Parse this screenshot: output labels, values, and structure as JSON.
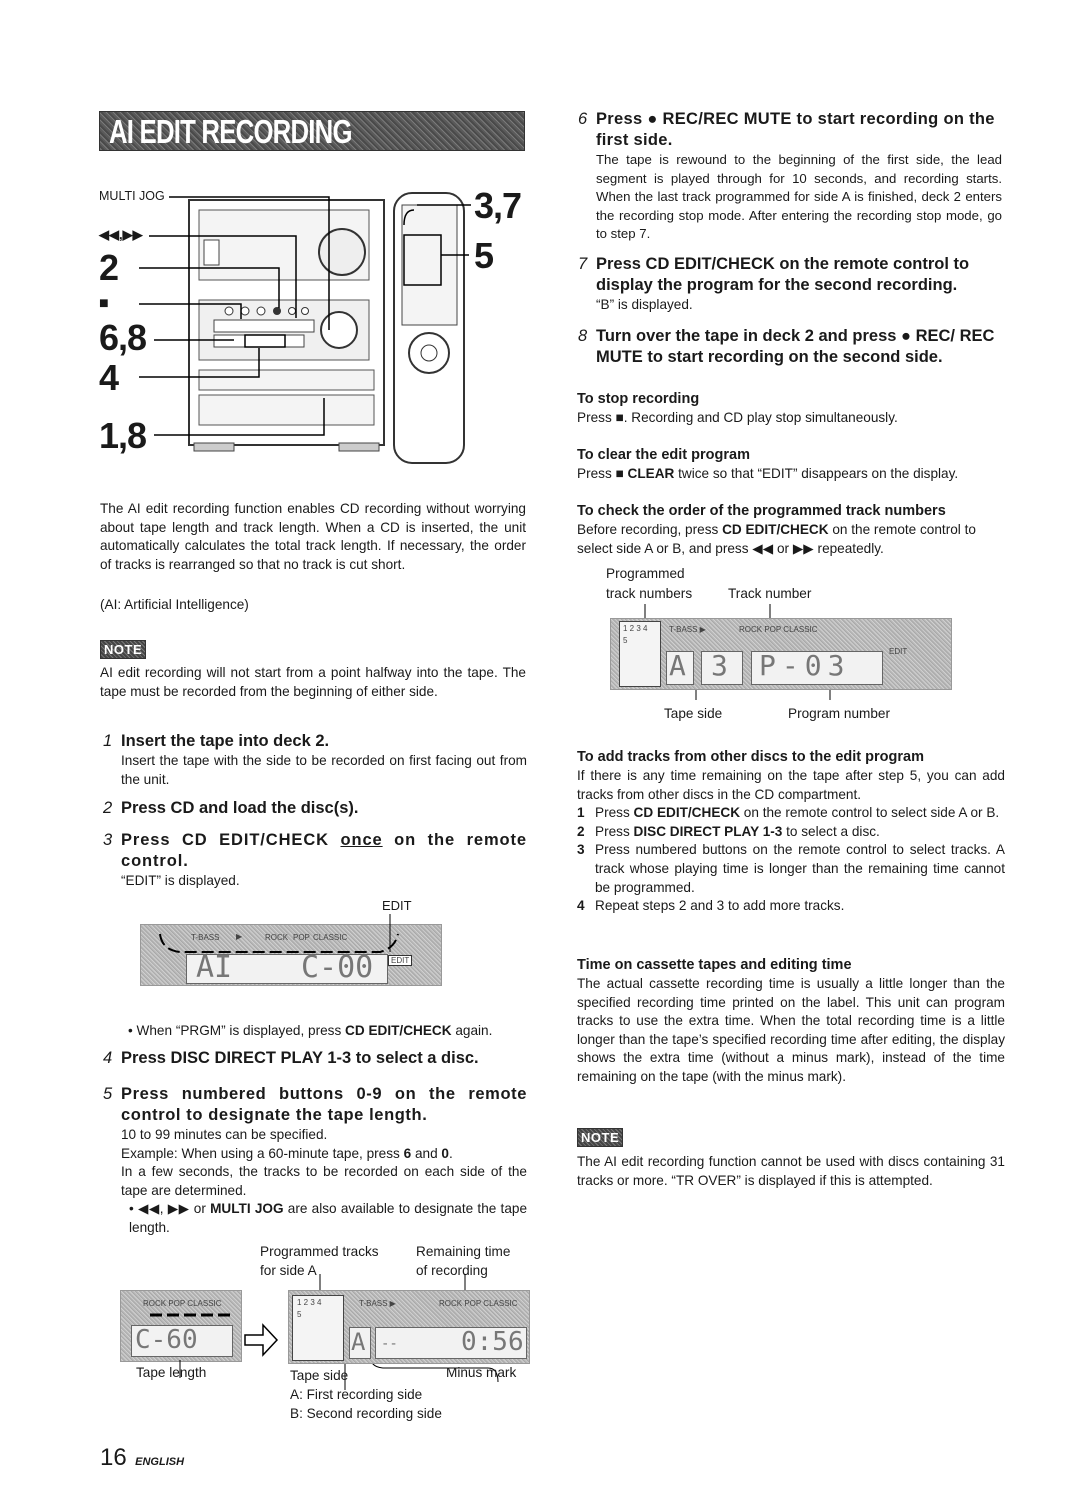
{
  "title": "AI EDIT RECORDING",
  "figure_device": {
    "labels": {
      "multi_jog": "MULTI JOG",
      "skip": "◀◀,▶▶",
      "step2": "2",
      "stop": "■",
      "step68": "6,8",
      "step4": "4",
      "step18": "1,8",
      "step37": "3,7",
      "step5": "5"
    }
  },
  "intro": {
    "paragraph": "The AI edit recording function enables CD recording without worrying about tape length and track length.  When a CD is inserted, the unit automatically calculates the total track length. If necessary, the order of tracks is rearranged so that no track is cut short.",
    "ai_def": "(AI: Artificial Intelligence)",
    "note_badge": "NOTE",
    "note_text": "AI edit recording will not start from a point halfway into the tape. The tape must be recorded from the beginning of either side."
  },
  "steps_left": [
    {
      "num": "1",
      "heading": "Insert the tape into deck 2.",
      "body": "Insert the tape with the side to be recorded on first facing out from the unit."
    },
    {
      "num": "2",
      "heading": "Press CD and load the disc(s).",
      "body": ""
    },
    {
      "num": "3",
      "heading_pre": "Press CD EDIT/CHECK ",
      "heading_underline": "once",
      "heading_post": " on the remote control.",
      "body": "“EDIT” is displayed."
    },
    {
      "num": "4",
      "heading": "Press DISC DIRECT PLAY 1-3 to select a disc.",
      "body": ""
    },
    {
      "num": "5",
      "heading": "Press numbered buttons 0-9 on the remote control to designate the tape length.",
      "body": "10 to 99 minutes can be specified."
    }
  ],
  "fig_edit": {
    "callout": "EDIT",
    "lcd_indicators": [
      "T-BASS",
      "▶",
      "ROCK",
      "POP",
      "CLASSIC"
    ],
    "edit_tag": "EDIT",
    "left_digits": "AI",
    "right_digits": "C-00"
  },
  "step3_bullet_pre": "• When “PRGM” is displayed, press ",
  "step3_bullet_bold": "CD EDIT/CHECK",
  "step3_bullet_post": " again.",
  "step5_extra": {
    "example_pre": "Example:  When using a 60-minute tape, press ",
    "example_b1": "6",
    "example_mid": " and ",
    "example_b2": "0",
    "example_post": ".",
    "determined": "In a few seconds, the tracks to be recorded on each side of the tape are determined.",
    "bullet_pre": "• ◀◀, ▶▶ or ",
    "bullet_bold": "MULTI JOG",
    "bullet_post": " are also available to designate the tape length."
  },
  "fig_tape": {
    "label_programmed": "Programmed tracks\nfor side A",
    "label_programmed_1": "Programmed tracks",
    "label_programmed_2": "for side A",
    "label_remaining_1": "Remaining time",
    "label_remaining_2": "of recording",
    "label_tape_length": "Tape length",
    "label_tape_side": "Tape side",
    "label_minus": "Minus mark",
    "side_a": "A: First recording side",
    "side_b": "B: Second recording side",
    "lcd1_indicators": "ROCK  POP CLASSIC",
    "lcd1_digits": "C-60",
    "lcd2_tracks": "1 2 3 4",
    "lcd2_track5": "5",
    "lcd2_indicators_left": "T-BASS  ▶",
    "lcd2_indicators_right": "ROCK  POP CLASSIC",
    "lcd2_side": "A",
    "lcd2_minus": "--",
    "lcd2_time": "0:56"
  },
  "footer": {
    "page": "16",
    "lang": "ENGLISH"
  },
  "steps_right": [
    {
      "num": "6",
      "heading": "Press ● REC/REC MUTE to start recording on the first side.",
      "body": "The tape is rewound to the beginning of the first side, the lead segment is played through for 10 seconds, and recording starts. When the last track programmed for side A is finished, deck 2 enters the recording stop mode. After entering the recording stop mode, go to step 7."
    },
    {
      "num": "7",
      "heading": "Press CD EDIT/CHECK on the remote control to display the program for the second recording.",
      "body": "“B” is displayed."
    },
    {
      "num": "8",
      "heading": "Turn over the tape in deck 2 and press ● REC/ REC MUTE to start recording on the second side.",
      "body": ""
    }
  ],
  "to_stop": {
    "heading": "To stop recording",
    "body": "Press ■. Recording and CD play stop simultaneously."
  },
  "to_clear": {
    "heading": "To clear the edit program",
    "pre": "Press ■ ",
    "bold": "CLEAR",
    "post": " twice so that “EDIT” disappears on the display."
  },
  "to_check": {
    "heading": "To check the order of the programmed track numbers",
    "pre": "Before recording, press ",
    "bold": "CD EDIT/CHECK",
    "post": " on the remote control to select side A or B, and press ◀◀ or ▶▶ repeatedly.",
    "fig": {
      "label_programmed_1": "Programmed",
      "label_programmed_2": "track numbers",
      "label_track": "Track number",
      "label_tape_side": "Tape side",
      "label_program": "Program number",
      "tracks": "1 2 3 4",
      "track5": "5",
      "indicators_left": "T-BASS   ▶",
      "indicators_right": "ROCK  POP CLASSIC",
      "edit_label": "EDIT",
      "side": "A",
      "track_digit": "3",
      "program": "P-03"
    }
  },
  "to_add": {
    "heading": "To add tracks from other discs to the edit program",
    "body": "If there is any time remaining on the tape after step 5, you can add tracks from other discs in the CD compartment.",
    "items": [
      {
        "n": "1",
        "pre": "Press ",
        "bold": "CD EDIT/CHECK",
        "post": " on the remote control to select side A or B."
      },
      {
        "n": "2",
        "pre": "Press ",
        "bold": "DISC DIRECT PLAY 1-3",
        "post": " to select a disc."
      },
      {
        "n": "3",
        "pre": "Press numbered buttons on the remote control to select tracks. A track whose playing time is longer than the remaining time cannot be programmed.",
        "bold": "",
        "post": ""
      },
      {
        "n": "4",
        "pre": "Repeat steps 2 and 3 to add more tracks.",
        "bold": "",
        "post": ""
      }
    ]
  },
  "time_on_cassette": {
    "heading": "Time on cassette tapes and editing time",
    "body": "The actual cassette recording time is usually a little longer than the specified recording time printed on the label.  This unit can program tracks to use the extra time.  When the total recording time is a little longer than the tape’s specified recording time after editing, the display shows the extra time (without a minus mark), instead of the time remaining on the tape (with the minus mark)."
  },
  "note2": {
    "badge": "NOTE",
    "text": "The AI edit recording function cannot be used with discs containing 31 tracks or more. “TR OVER” is displayed if this is attempted."
  }
}
